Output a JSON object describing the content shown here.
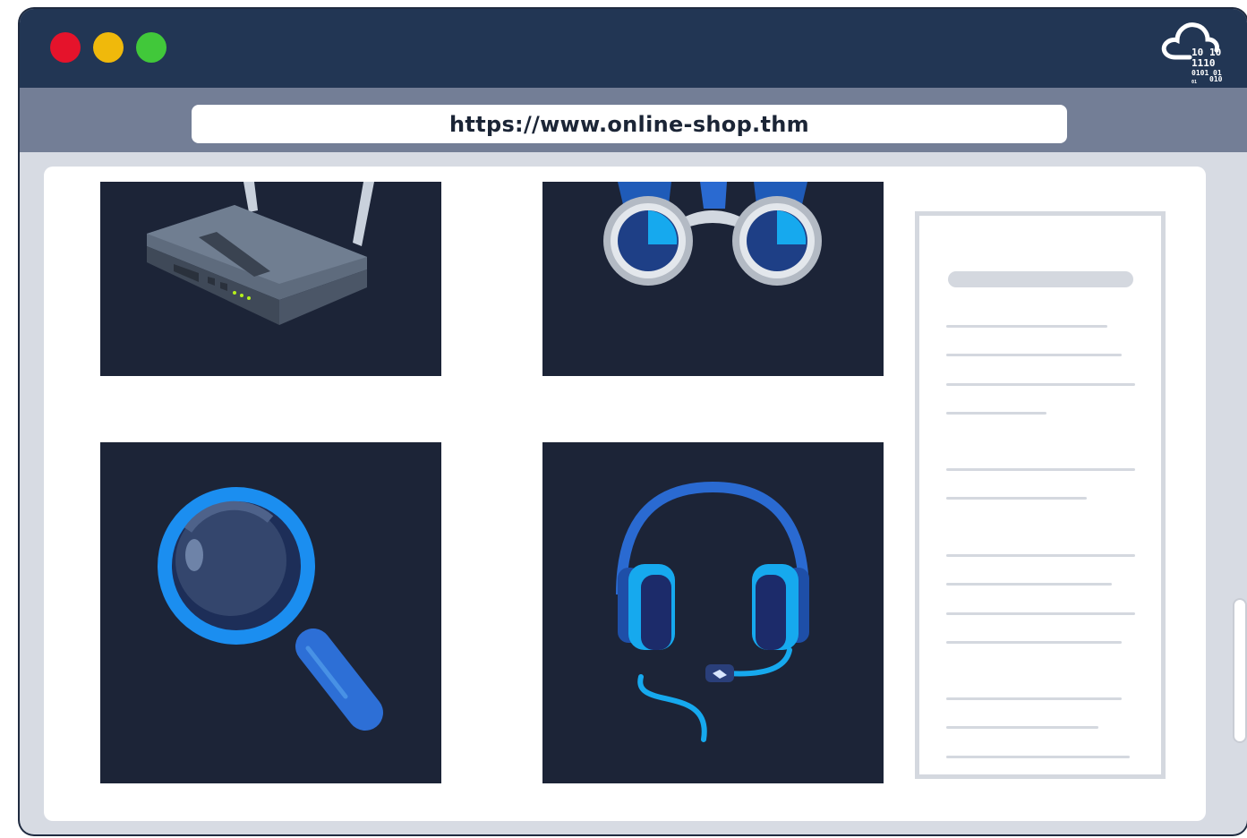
{
  "browser": {
    "window_controls": [
      {
        "name": "close",
        "color": "#e5132b"
      },
      {
        "name": "minimize",
        "color": "#f0b90b"
      },
      {
        "name": "maximize",
        "color": "#41c83a"
      }
    ],
    "logo": {
      "icon": "cloud-binary-icon",
      "digits": [
        "10",
        "10",
        "1110",
        "0101",
        "01",
        "01",
        "010"
      ]
    },
    "url": "https://www.online-shop.thm"
  },
  "page": {
    "products": [
      {
        "icon": "wifi-router-icon"
      },
      {
        "icon": "binoculars-icon"
      },
      {
        "icon": "magnifying-glass-icon"
      },
      {
        "icon": "headset-icon"
      }
    ],
    "sidebar": {
      "type": "placeholder-document"
    }
  },
  "colors": {
    "titlebar": "#223654",
    "addressbar_area": "#737e96",
    "tile_background": "#1c2437",
    "accent_blue": "#1e8be0",
    "placeholder_gray": "#d4d8df"
  }
}
